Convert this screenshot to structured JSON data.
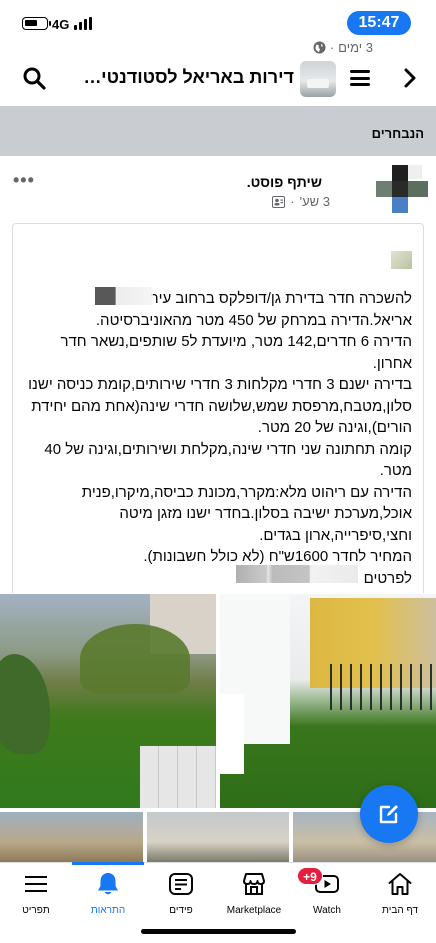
{
  "status_bar": {
    "time": "15:47",
    "network": "4G"
  },
  "header": {
    "group_title": "דירות באריאל לסטודנטים ד..."
  },
  "section": {
    "title": "הנבחרים"
  },
  "post": {
    "shared_text": "שיתף פוסט.",
    "time": "3 שע'",
    "dot": "·",
    "inner_time": "3 ימים",
    "inner_dot": "·",
    "body_lines": [
      "להשכרה חדר בדירת גן/דופלקס ברחוב עיר",
      "אריאל.הדירה במרחק של 450 מטר מהאוניברסיטה.",
      "הדירה 6 חדרים,142 מטר, מיועדת ל5 שותפים,נשאר חדר",
      "אחרון.",
      "בדירה ישנם 3 חדרי מקלחות 3 חדרי שירותים,קומת כניסה ישנו",
      "סלון,מטבח,מרפסת שמש,שלושה חדרי שינה(אחת מהם יחידת",
      "הורים),וגינה של 20 מטר.",
      "קומה תחתונה שני חדרי שינה,מקלחת ושירותים,וגינה של 40",
      "מטר.",
      "הדירה עם ריהוט מלא:מקרר,מכונת כביסה,מיקרו,פנית",
      "אוכל,מערכת ישיבה בסלון.בחדר ישנו מזגן מיטה",
      "וחצי,סיפרייה,ארון בגדים.",
      "המחיר לחדר 1600ש\"ח (לא כולל חשבונות).",
      "לפרטים"
    ]
  },
  "tabs": [
    {
      "key": "menu",
      "label": "תפריט",
      "icon": "menu-icon"
    },
    {
      "key": "notifications",
      "label": "התראות",
      "icon": "bell-icon",
      "active": true
    },
    {
      "key": "feeds",
      "label": "פידים",
      "icon": "feeds-icon"
    },
    {
      "key": "marketplace",
      "label": "Marketplace",
      "icon": "marketplace-icon"
    },
    {
      "key": "watch",
      "label": "Watch",
      "icon": "watch-icon",
      "badge": "+9"
    },
    {
      "key": "home",
      "label": "דף הבית",
      "icon": "home-icon"
    }
  ],
  "colors": {
    "accent": "#1877f2",
    "badge": "#e41e3f",
    "section_bg": "#c9ccd1",
    "meta_text": "#65676b"
  }
}
